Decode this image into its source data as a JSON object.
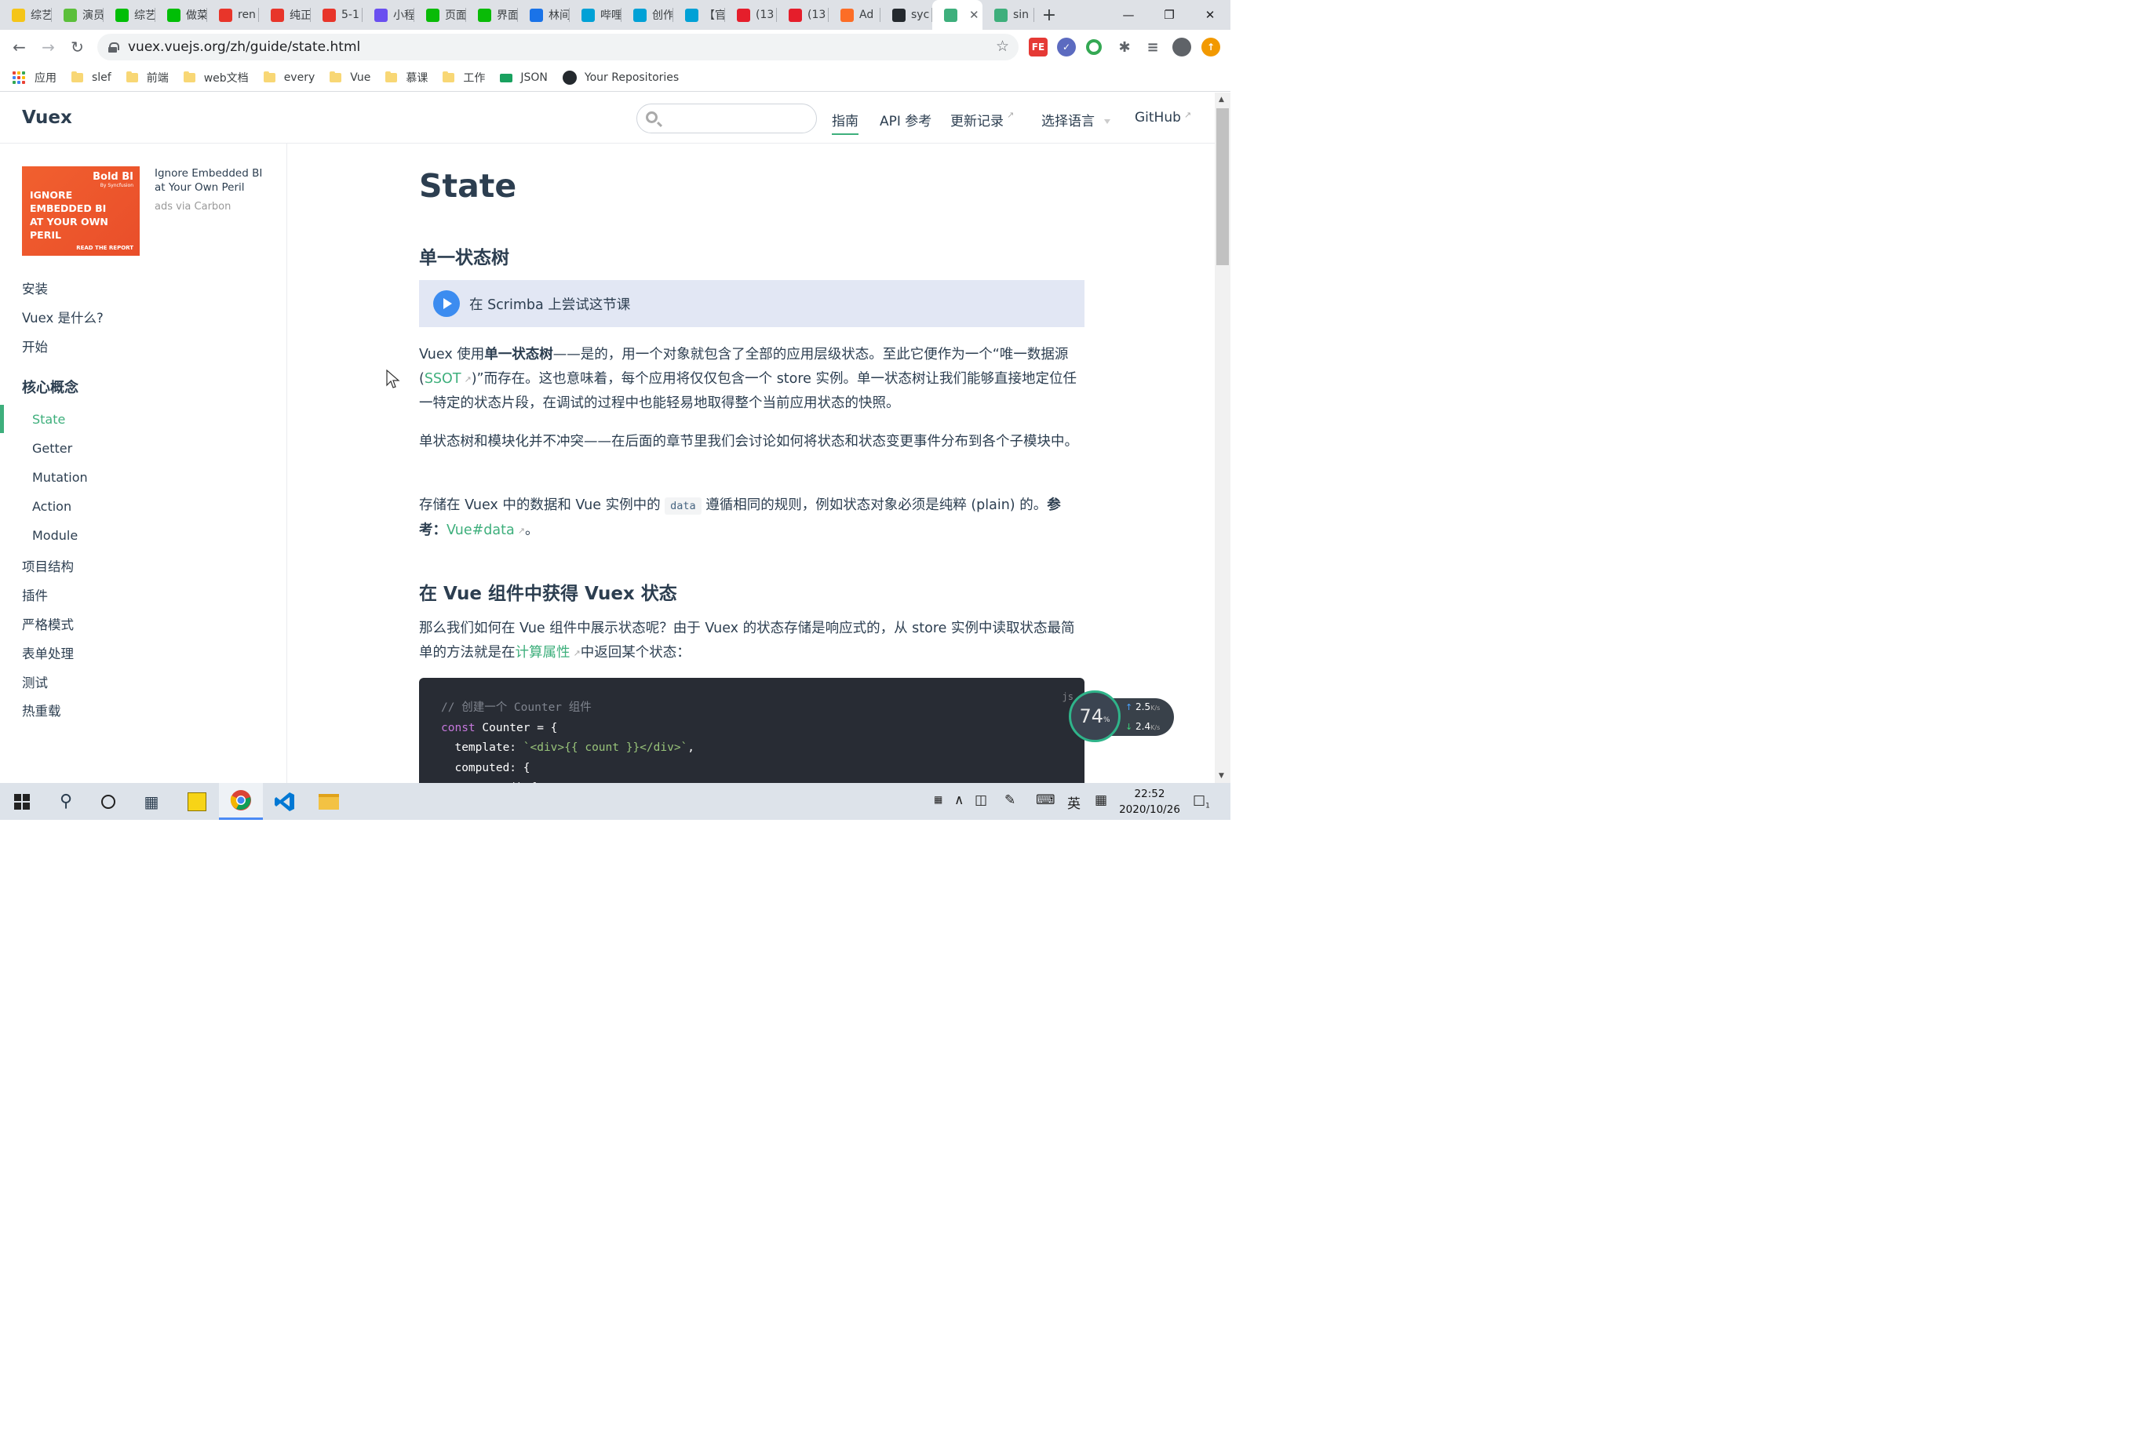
{
  "browser": {
    "tabs": [
      {
        "title": "综艺",
        "icon": "youtube-play-icon",
        "color": "#f5c518"
      },
      {
        "title": "演员",
        "icon": "play-icon",
        "color": "#5bbf3a"
      },
      {
        "title": "综艺",
        "icon": "iqiyi-icon",
        "color": "#00be06"
      },
      {
        "title": "做菜",
        "icon": "iqiyi-icon",
        "color": "#00be06"
      },
      {
        "title": "ren",
        "icon": "flame-icon",
        "color": "#e8352a"
      },
      {
        "title": "纯正",
        "icon": "flame-icon",
        "color": "#e8352a"
      },
      {
        "title": "5-1",
        "icon": "flame-icon",
        "color": "#e8352a"
      },
      {
        "title": "小程",
        "icon": "link-icon",
        "color": "#6a4ff0"
      },
      {
        "title": "页面",
        "icon": "wechat-icon",
        "color": "#09bb07"
      },
      {
        "title": "界面",
        "icon": "wechat-icon",
        "color": "#09bb07"
      },
      {
        "title": "林间",
        "icon": "spark-icon",
        "color": "#1a73e8"
      },
      {
        "title": "哔哩",
        "icon": "bilibili-icon",
        "color": "#00a1d6"
      },
      {
        "title": "创作",
        "icon": "bilibili-icon",
        "color": "#00a1d6"
      },
      {
        "title": "【官",
        "icon": "bilibili-icon",
        "color": "#00a1d6"
      },
      {
        "title": "(13",
        "icon": "csdn-icon",
        "color": "#e51e2b"
      },
      {
        "title": "(13",
        "icon": "csdn-icon",
        "color": "#e51e2b"
      },
      {
        "title": "Ad",
        "icon": "gitlab-icon",
        "color": "#fc6d26"
      },
      {
        "title": "syc",
        "icon": "github-icon",
        "color": "#24292e"
      },
      {
        "title": "",
        "icon": "vue-icon",
        "color": "#3eaf7c",
        "active": true
      },
      {
        "title": "sin",
        "icon": "vue-icon",
        "color": "#3eaf7c"
      }
    ],
    "url": "vuex.vuejs.org/zh/guide/state.html",
    "bookmarks": [
      "应用",
      "slef",
      "前端",
      "web文档",
      "every",
      "Vue",
      "慕课",
      "工作",
      "JSON",
      "Your Repositories"
    ]
  },
  "site": {
    "logo": "Vuex",
    "search_placeholder": "",
    "nav": {
      "guide": "指南",
      "api": "API 参考",
      "changelog": "更新记录",
      "language": "选择语言",
      "github": "GitHub"
    }
  },
  "ad": {
    "brand": "Bold BI",
    "brand_sub": "By Syncfusion",
    "headline": "IGNORE EMBEDDED BI AT YOUR OWN PERIL",
    "cta": "READ THE REPORT",
    "text": "Ignore Embedded BI at Your Own Peril",
    "via": "ads via Carbon"
  },
  "sidebar": {
    "top": [
      "安装",
      "Vuex 是什么?",
      "开始"
    ],
    "group": "核心概念",
    "sub": [
      "State",
      "Getter",
      "Mutation",
      "Action",
      "Module"
    ],
    "bottom": [
      "项目结构",
      "插件",
      "严格模式",
      "表单处理",
      "测试",
      "热重载"
    ]
  },
  "content": {
    "title": "State",
    "h2_1": "单一状态树",
    "scrimba": "在 Scrimba 上尝试这节课",
    "p1_a": "Vuex 使用",
    "p1_b": "单一状态树",
    "p1_c": "——是的，用一个对象就包含了全部的应用层级状态。至此它便作为一个“唯一数据源 (",
    "p1_link": "SSOT",
    "p1_d": ")”而存在。这也意味着，每个应用将仅仅包含一个 store 实例。单一状态树让我们能够直接地定位任一特定的状态片段，在调试的过程中也能轻易地取得整个当前应用状态的快照。",
    "p2": "单状态树和模块化并不冲突——在后面的章节里我们会讨论如何将状态和状态变更事件分布到各个子模块中。",
    "p3_a": "存储在 Vuex 中的数据和 Vue 实例中的",
    "p3_code": "data",
    "p3_b": "遵循相同的规则，例如状态对象必须是纯粹 (plain) 的。",
    "p3_c": "参考：",
    "p3_link": "Vue#data",
    "p3_end": "。",
    "h2_2": "在 Vue 组件中获得 Vuex 状态",
    "p4_a": "那么我们如何在 Vue 组件中展示状态呢？由于 Vuex 的状态存储是响应式的，从 store 实例中读取状态最简单的方法就是在",
    "p4_link": "计算属性",
    "p4_b": "中返回某个状态：",
    "code_lang": "js",
    "code": {
      "l1": "// 创建一个 Counter 组件",
      "l2_kw": "const",
      "l2_rest": " Counter = {",
      "l3_a": "  template: ",
      "l3_str": "`<div>{{ count }}</div>`",
      "l3_b": ",",
      "l4": "  computed: {",
      "l5": "    count () {"
    }
  },
  "netmon": {
    "percent": "74",
    "unit": "%",
    "up": "2.5",
    "down": "2.4",
    "rate_unit": "K/s"
  },
  "taskbar": {
    "ime": "英",
    "time": "22:52",
    "date": "2020/10/26",
    "notifications": "1"
  }
}
